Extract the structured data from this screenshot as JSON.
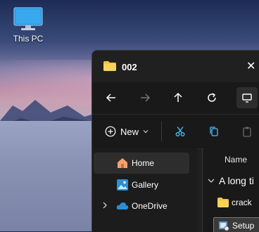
{
  "desktop": {
    "icons": [
      {
        "label": "This PC",
        "icon": "monitor-icon"
      }
    ]
  },
  "window": {
    "tab_title": "002",
    "close_glyph": "✕",
    "nav": {
      "back_icon": "arrow-left-icon",
      "forward_icon": "arrow-right-icon",
      "up_icon": "arrow-up-icon",
      "refresh_icon": "refresh-icon",
      "view_icon": "monitor-icon"
    },
    "toolbar": {
      "new_label": "New",
      "cut_icon": "scissors-icon",
      "copy_icon": "copy-icon",
      "paste_icon": "clipboard-icon"
    },
    "sidebar": {
      "items": [
        {
          "label": "Home",
          "icon": "home-icon",
          "selected": true
        },
        {
          "label": "Gallery",
          "icon": "gallery-icon",
          "selected": false
        },
        {
          "label": "OneDrive",
          "icon": "cloud-icon",
          "selected": false,
          "expandable": true
        }
      ]
    },
    "content": {
      "column_header": "Name",
      "group_label": "A long ti",
      "files": [
        {
          "name": "crack",
          "icon": "folder-icon"
        },
        {
          "name": "Setup",
          "icon": "setup-icon",
          "hovered": true
        }
      ]
    }
  },
  "colors": {
    "window_bg": "#1f1f1f",
    "folder_yellow": "#f5c542",
    "accent_blue": "#4cc2ff"
  }
}
